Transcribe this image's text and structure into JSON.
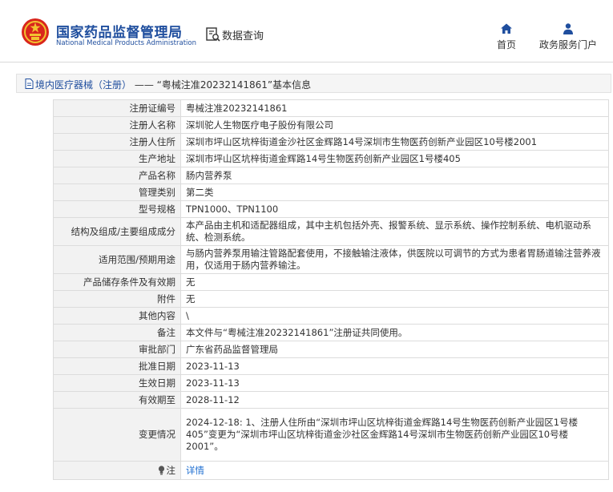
{
  "header": {
    "brand_cn": "国家药品监督管理局",
    "brand_en": "National Medical Products Administration",
    "query_label": "数据查询",
    "nav": [
      {
        "label": "首页",
        "icon": "home-icon"
      },
      {
        "label": "政务服务门户",
        "icon": "user-icon"
      }
    ]
  },
  "breadcrumb": {
    "category": "境内医疗器械（注册）",
    "separator": "——",
    "title": "“粤械注准20232141861”基本信息"
  },
  "rows": [
    {
      "key": "注册证编号",
      "value": "粤械注准20232141861"
    },
    {
      "key": "注册人名称",
      "value": "深圳驼人生物医疗电子股份有限公司"
    },
    {
      "key": "注册人住所",
      "value": "深圳市坪山区坑梓街道金沙社区金辉路14号深圳市生物医药创新产业园区10号楼2001"
    },
    {
      "key": "生产地址",
      "value": "深圳市坪山区坑梓街道金辉路14号生物医药创新产业园区1号楼405"
    },
    {
      "key": "产品名称",
      "value": "肠内营养泵"
    },
    {
      "key": "管理类别",
      "value": "第二类"
    },
    {
      "key": "型号规格",
      "value": "TPN1000、TPN1100"
    },
    {
      "key": "结构及组成/主要组成成分",
      "value": "本产品由主机和适配器组成，其中主机包括外壳、报警系统、显示系统、操作控制系统、电机驱动系统、检测系统。"
    },
    {
      "key": "适用范围/预期用途",
      "value": "与肠内营养泵用输注管路配套使用，不接触输注液体，供医院以可调节的方式为患者胃肠道输注营养液用，仅适用于肠内营养输注。"
    },
    {
      "key": "产品储存条件及有效期",
      "value": "无"
    },
    {
      "key": "附件",
      "value": "无"
    },
    {
      "key": "其他内容",
      "value": "\\"
    },
    {
      "key": "备注",
      "value": "本文件与“粤械注准20232141861”注册证共同使用。"
    },
    {
      "key": "审批部门",
      "value": "广东省药品监督管理局"
    },
    {
      "key": "批准日期",
      "value": "2023-11-13"
    },
    {
      "key": "生效日期",
      "value": "2023-11-13"
    },
    {
      "key": "有效期至",
      "value": "2028-11-12"
    },
    {
      "key": "变更情况",
      "value": "2024-12-18: 1、注册人住所由“深圳市坪山区坑梓街道金辉路14号生物医药创新产业园区1号楼405”变更为“深圳市坪山区坑梓街道金沙社区金辉路14号深圳市生物医药创新产业园区10号楼2001”。"
    }
  ],
  "note": {
    "key": "注",
    "link": "详情"
  },
  "colors": {
    "brand": "#1f4e9e",
    "link": "#1f6fd1",
    "key_bg": "#f2f2f2"
  }
}
